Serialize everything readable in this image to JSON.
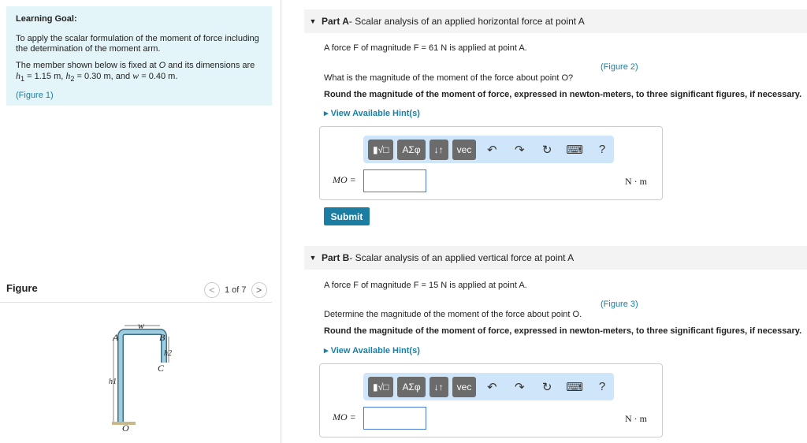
{
  "goal": {
    "title": "Learning Goal:",
    "p1": "To apply the scalar formulation of the moment of force including the determination of the moment arm.",
    "p2a": "The member shown below is fixed at ",
    "p2o": "O",
    "p2b": " and its dimensions are",
    "h1": "h",
    "h1v": " = 1.15 m, ",
    "h2v": " = 0.30 m, and ",
    "w": "w",
    "wv": " = 0.40 m.",
    "fig": "(Figure 1)"
  },
  "figure": {
    "title": "Figure",
    "pager": "1 of 7",
    "labels": {
      "A": "A",
      "B": "B",
      "C": "C",
      "O": "O",
      "w": "w",
      "h1": "h1",
      "h2": "h2"
    }
  },
  "partA": {
    "label": "Part A",
    "title": " - Scalar analysis of an applied horizontal force at point A",
    "force": "A force F of magnitude F = 61 N is applied at point A.",
    "fig": "(Figure 2)",
    "question": "What is the magnitude of the moment of the force about point O?",
    "instr": "Round the magnitude of the moment of force, expressed in newton-meters, to three significant figures, if necessary.",
    "hint": "View Available Hint(s)",
    "var": "MO =",
    "unit": "N · m",
    "submit": "Submit"
  },
  "partB": {
    "label": "Part B",
    "title": " - Scalar analysis of an applied vertical force at point A",
    "force": "A force F of magnitude F = 15 N is applied at point A.",
    "fig": "(Figure 3)",
    "question": "Determine the magnitude of the moment of the force about point O.",
    "instr": "Round the magnitude of the moment of force, expressed in newton-meters, to three significant figures, if necessary.",
    "hint": "View Available Hint(s)",
    "var": "MO =",
    "unit": "N · m"
  },
  "toolbar": {
    "templates": "▮√□",
    "greek": "ΑΣφ",
    "arrows": "↓↑",
    "vec": "vec",
    "help": "?"
  }
}
